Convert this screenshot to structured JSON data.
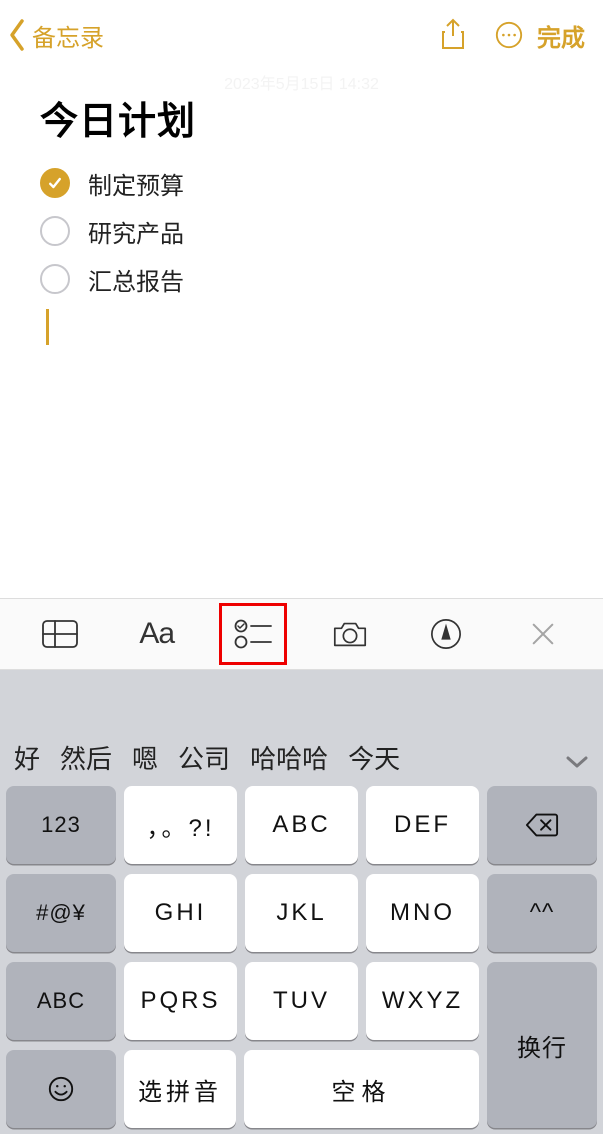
{
  "nav": {
    "back_label": "备忘录",
    "done_label": "完成"
  },
  "note": {
    "timestamp": "2023年5月15日 14:32",
    "title": "今日计划",
    "checklist": [
      {
        "text": "制定预算",
        "checked": true
      },
      {
        "text": "研究产品",
        "checked": false
      },
      {
        "text": "汇总报告",
        "checked": false
      }
    ]
  },
  "format_toolbar": {
    "aa_label": "Aa"
  },
  "keyboard": {
    "suggestions": [
      "好",
      "然后",
      "嗯",
      "公司",
      "哈哈哈",
      "今天"
    ],
    "fn": {
      "num": "123",
      "sym": "#@¥",
      "abc": "ABC",
      "punc": "，。?!",
      "face": "^^",
      "return": "换行",
      "pinyin": "选拼音",
      "space": "空格"
    },
    "letters": {
      "r1": [
        "ABC",
        "DEF"
      ],
      "r2": [
        "GHI",
        "JKL",
        "MNO"
      ],
      "r3": [
        "PQRS",
        "TUV",
        "WXYZ"
      ]
    }
  }
}
